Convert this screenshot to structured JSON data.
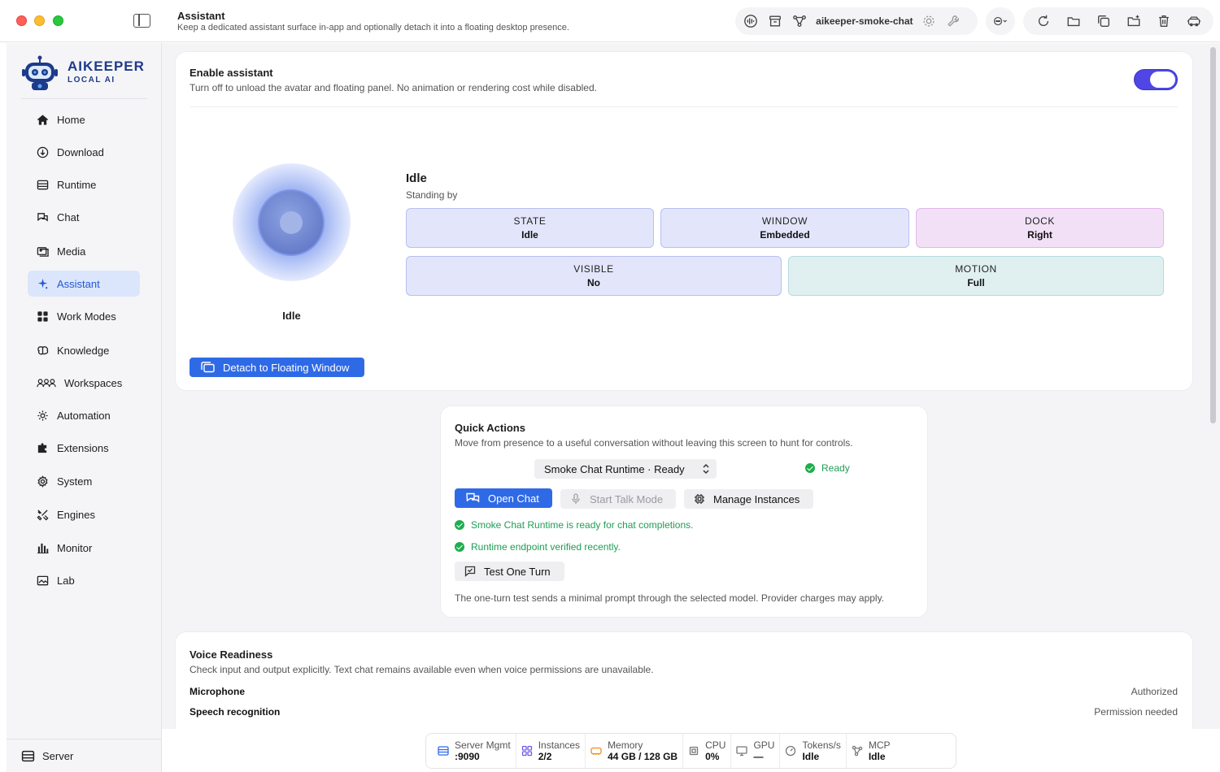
{
  "header": {
    "title": "Assistant",
    "subtitle": "Keep a dedicated assistant surface in-app and optionally detach it into a floating desktop presence.",
    "model_name": "aikeeper-smoke-chat"
  },
  "brand": {
    "name": "AIKEEPER",
    "tagline": "LOCAL AI"
  },
  "sidebar": {
    "items": [
      {
        "label": "Home",
        "icon": "home-icon"
      },
      {
        "label": "Download",
        "icon": "download-icon"
      },
      {
        "label": "Runtime",
        "icon": "runtime-icon"
      },
      {
        "label": "Chat",
        "icon": "chat-icon"
      },
      {
        "label": "Media",
        "icon": "media-icon"
      },
      {
        "label": "Assistant",
        "icon": "sparkle-icon",
        "active": true
      },
      {
        "label": "Work Modes",
        "icon": "grid-icon"
      },
      {
        "label": "Knowledge",
        "icon": "brain-icon"
      },
      {
        "label": "Workspaces",
        "icon": "users-icon"
      },
      {
        "label": "Automation",
        "icon": "automation-icon"
      },
      {
        "label": "Extensions",
        "icon": "puzzle-icon"
      },
      {
        "label": "System",
        "icon": "gear-icon"
      },
      {
        "label": "Engines",
        "icon": "tools-icon"
      },
      {
        "label": "Monitor",
        "icon": "bar-chart-icon"
      },
      {
        "label": "Lab",
        "icon": "image-icon"
      }
    ],
    "footer": {
      "label": "Server",
      "icon": "server-icon"
    }
  },
  "enable_card": {
    "title": "Enable assistant",
    "subtitle": "Turn off to unload the avatar and floating panel. No animation or rendering cost while disabled.",
    "enabled": true
  },
  "avatar": {
    "label": "Idle",
    "state_title": "Idle",
    "state_subtitle": "Standing by",
    "stats": [
      {
        "label": "STATE",
        "value": "Idle"
      },
      {
        "label": "WINDOW",
        "value": "Embedded"
      },
      {
        "label": "DOCK",
        "value": "Right"
      },
      {
        "label": "VISIBLE",
        "value": "No"
      },
      {
        "label": "MOTION",
        "value": "Full"
      }
    ],
    "detach_label": "Detach to Floating Window"
  },
  "quick_actions": {
    "title": "Quick Actions",
    "subtitle": "Move from presence to a useful conversation without leaving this screen to hunt for controls.",
    "runtime_select": "Smoke Chat Runtime · Ready",
    "status": "Ready",
    "open_chat": "Open Chat",
    "talk_mode": "Start Talk Mode",
    "manage": "Manage Instances",
    "checks": [
      "Smoke Chat Runtime is ready for chat completions.",
      "Runtime endpoint verified recently."
    ],
    "test_turn": "Test One Turn",
    "note": "The one-turn test sends a minimal prompt through the selected model. Provider charges may apply."
  },
  "voice": {
    "title": "Voice Readiness",
    "subtitle": "Check input and output explicitly. Text chat remains available even when voice permissions are unavailable.",
    "rows": [
      {
        "label": "Microphone",
        "value": "Authorized"
      },
      {
        "label": "Speech recognition",
        "value": "Permission needed"
      }
    ]
  },
  "statusbar": [
    {
      "label": "Server Mgmt",
      "value": ":9090",
      "icon": "server-icon",
      "color": "#2f6ae6"
    },
    {
      "label": "Instances",
      "value": "2/2",
      "icon": "instances-icon",
      "color": "#6d5ce8"
    },
    {
      "label": "Memory",
      "value": "44 GB / 128 GB",
      "icon": "memory-icon",
      "color": "#f08a24"
    },
    {
      "label": "CPU",
      "value": "0%",
      "icon": "cpu-icon",
      "color": "#777777"
    },
    {
      "label": "GPU",
      "value": "—",
      "icon": "gpu-icon",
      "color": "#777777"
    },
    {
      "label": "Tokens/s",
      "value": "Idle",
      "icon": "gauge-icon",
      "color": "#777777"
    },
    {
      "label": "MCP",
      "value": "Idle",
      "icon": "mcp-icon",
      "color": "#777777"
    }
  ],
  "colors": {
    "accent": "#2f6ae6",
    "toggle_on": "#4f46e5",
    "success": "#1fae4f",
    "sidebar_active_bg": "#dbe5fb"
  }
}
